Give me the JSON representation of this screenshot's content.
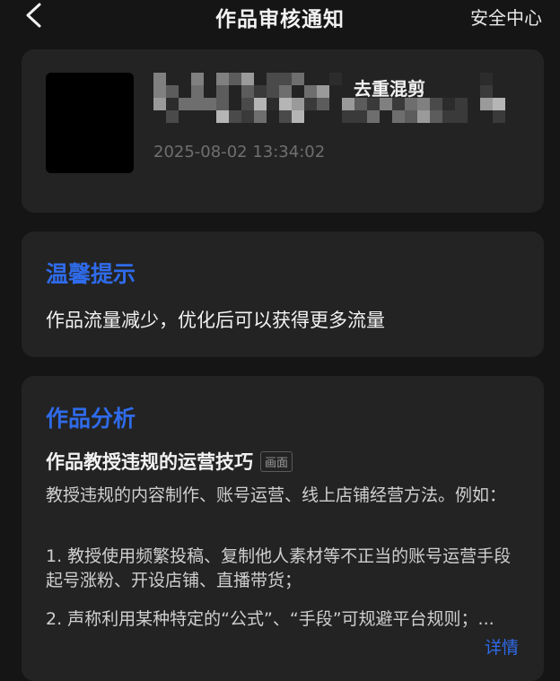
{
  "header": {
    "title": "作品审核通知",
    "right_link": "安全中心"
  },
  "video": {
    "title_visible": "去重混剪",
    "date": "2025-08-02 13:34:02"
  },
  "tip": {
    "heading": "温馨提示",
    "text": "作品流量减少，优化后可以获得更多流量"
  },
  "analysis": {
    "heading": "作品分析",
    "rule_title": "作品教授违规的运营技巧",
    "rule_tag": "画面",
    "para1": "教授违规的内容制作、账号运营、线上店铺经营方法。例如：",
    "para2": "1. 教授使用频繁投稿、复制他人素材等不正当的账号运营手段起号涨粉、开设店铺、直播带货；",
    "para3": "2. 声称利用某种特定的“公式”、“手段”可规避平台规则；...",
    "detail_link": "详情"
  }
}
